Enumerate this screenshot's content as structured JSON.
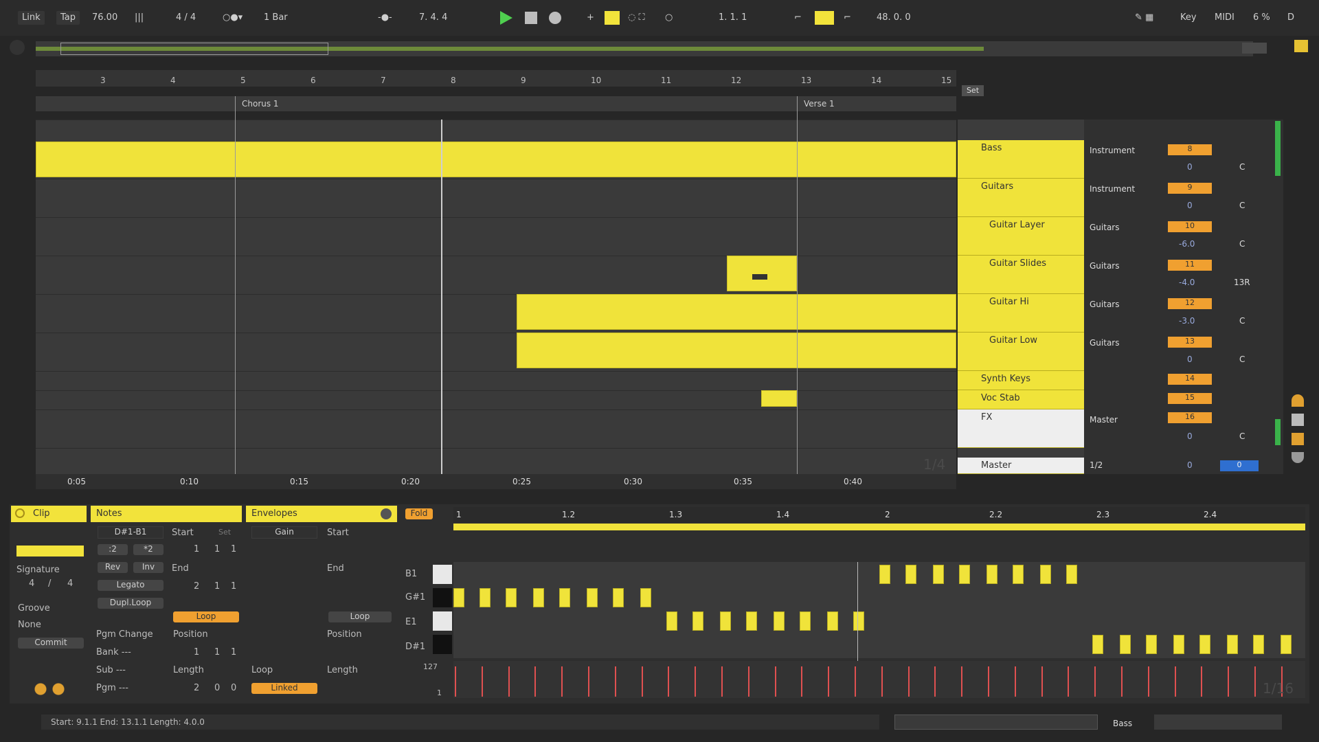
{
  "toolbar": {
    "link": "Link",
    "tap": "Tap",
    "tempo": "76.00",
    "signature": "4 / 4",
    "quantize": "1 Bar",
    "position": "7.  4.  4",
    "loop_start": "1.  1.  1",
    "loop_length": "48.  0.  0",
    "key": "Key",
    "midi": "MIDI",
    "cpu": "6 %",
    "disk": "D"
  },
  "arrangement": {
    "ruler_bars": [
      "3",
      "4",
      "5",
      "6",
      "7",
      "8",
      "9",
      "10",
      "11",
      "12",
      "13",
      "14",
      "15"
    ],
    "locators": [
      "Chorus 1",
      "Verse 1"
    ],
    "time_ticks": [
      "0:05",
      "0:10",
      "0:15",
      "0:20",
      "0:25",
      "0:30",
      "0:35",
      "0:40"
    ],
    "set_label": "Set",
    "zoom_label": "1/4"
  },
  "tracks": [
    {
      "name": "Bass",
      "routing": "Instrument",
      "number": "8",
      "volume": "0",
      "pan": "C"
    },
    {
      "name": "Guitars",
      "routing": "Instrument",
      "number": "9",
      "volume": "0",
      "pan": "C"
    },
    {
      "name": "Guitar Layer",
      "routing": "Guitars",
      "number": "10",
      "volume": "-6.0",
      "pan": "C"
    },
    {
      "name": "Guitar Slides",
      "routing": "Guitars",
      "number": "11",
      "volume": "-4.0",
      "pan": "13R"
    },
    {
      "name": "Guitar Hi",
      "routing": "Guitars",
      "number": "12",
      "volume": "-3.0",
      "pan": "C"
    },
    {
      "name": "Guitar Low",
      "routing": "Guitars",
      "number": "13",
      "volume": "0",
      "pan": "C"
    },
    {
      "name": "Synth Keys",
      "routing": "",
      "number": "14",
      "volume": "",
      "pan": ""
    },
    {
      "name": "Voc Stab",
      "routing": "",
      "number": "15",
      "volume": "",
      "pan": ""
    },
    {
      "name": "FX",
      "routing": "Master",
      "number": "16",
      "volume": "0",
      "pan": "C"
    },
    {
      "name": "Master",
      "routing": "1/2",
      "number": "",
      "volume": "0",
      "pan": "0"
    }
  ],
  "clip_panel": {
    "title": "Clip",
    "signature_label": "Signature",
    "sig_num": "4",
    "sig_den": "4",
    "groove_label": "Groove",
    "groove_value": "None",
    "commit": "Commit"
  },
  "notes_panel": {
    "title": "Notes",
    "range": "D#1-B1",
    "div2": ":2",
    "mul2": "*2",
    "rev": "Rev",
    "inv": "Inv",
    "legato": "Legato",
    "dupl": "Dupl.Loop",
    "start_label": "Start",
    "start_vals": [
      "1",
      "1",
      "1"
    ],
    "end_label": "End",
    "end_vals": [
      "2",
      "1",
      "1"
    ],
    "loop": "Loop",
    "pgm_change": "Pgm Change",
    "position_label": "Position",
    "position_vals": [
      "1",
      "1",
      "1"
    ],
    "bank": "Bank ---",
    "sub": "Sub ---",
    "pgm": "Pgm ---",
    "length_label": "Length",
    "length_vals": [
      "2",
      "0",
      "0"
    ],
    "set": "Set"
  },
  "envelopes_panel": {
    "title": "Envelopes",
    "device": "Gain",
    "start_label": "Start",
    "end_label": "End",
    "loop_btn": "Loop",
    "position_label": "Position",
    "loop_label": "Loop",
    "length_label": "Length",
    "linked": "Linked"
  },
  "midi_editor": {
    "fold": "Fold",
    "ruler": [
      "1",
      "1.2",
      "1.3",
      "1.4",
      "2",
      "2.2",
      "2.3",
      "2.4"
    ],
    "keys": [
      "B1",
      "G#1",
      "E1",
      "D#1"
    ],
    "velocity_max": "127",
    "velocity_min": "1",
    "grid": "1/16"
  },
  "status": {
    "text": "Start: 9.1.1  End: 13.1.1  Length: 4.0.0",
    "track": "Bass"
  }
}
